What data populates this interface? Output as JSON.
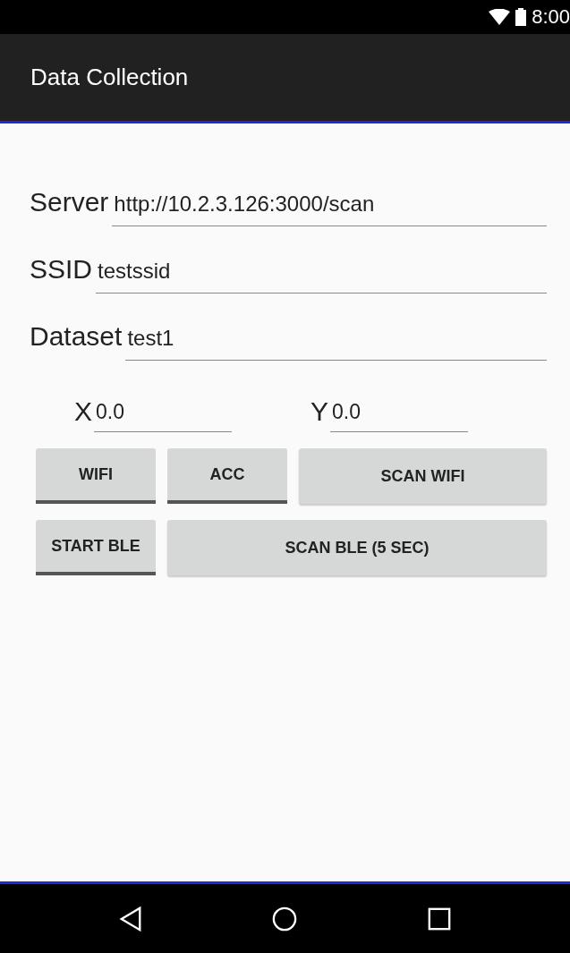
{
  "status_bar": {
    "time": "8:00"
  },
  "app_bar": {
    "title": "Data Collection"
  },
  "fields": [
    {
      "label": "Server",
      "value": "http://10.2.3.126:3000/scan"
    },
    {
      "label": "SSID",
      "value": "testssid"
    },
    {
      "label": "Dataset",
      "value": "test1"
    }
  ],
  "coordinates": [
    {
      "label": "X",
      "value": "0.0"
    },
    {
      "label": "Y",
      "value": "0.0"
    }
  ],
  "button_rows": [
    [
      {
        "kind": "toggle",
        "label": "WIFI",
        "on": false
      },
      {
        "kind": "toggle",
        "label": "ACC",
        "on": false
      },
      {
        "kind": "button",
        "label": "SCAN WIFI"
      }
    ],
    [
      {
        "kind": "toggle",
        "label": "START BLE",
        "on": false
      },
      {
        "kind": "button",
        "label": "SCAN BLE (5 SEC)"
      }
    ]
  ]
}
